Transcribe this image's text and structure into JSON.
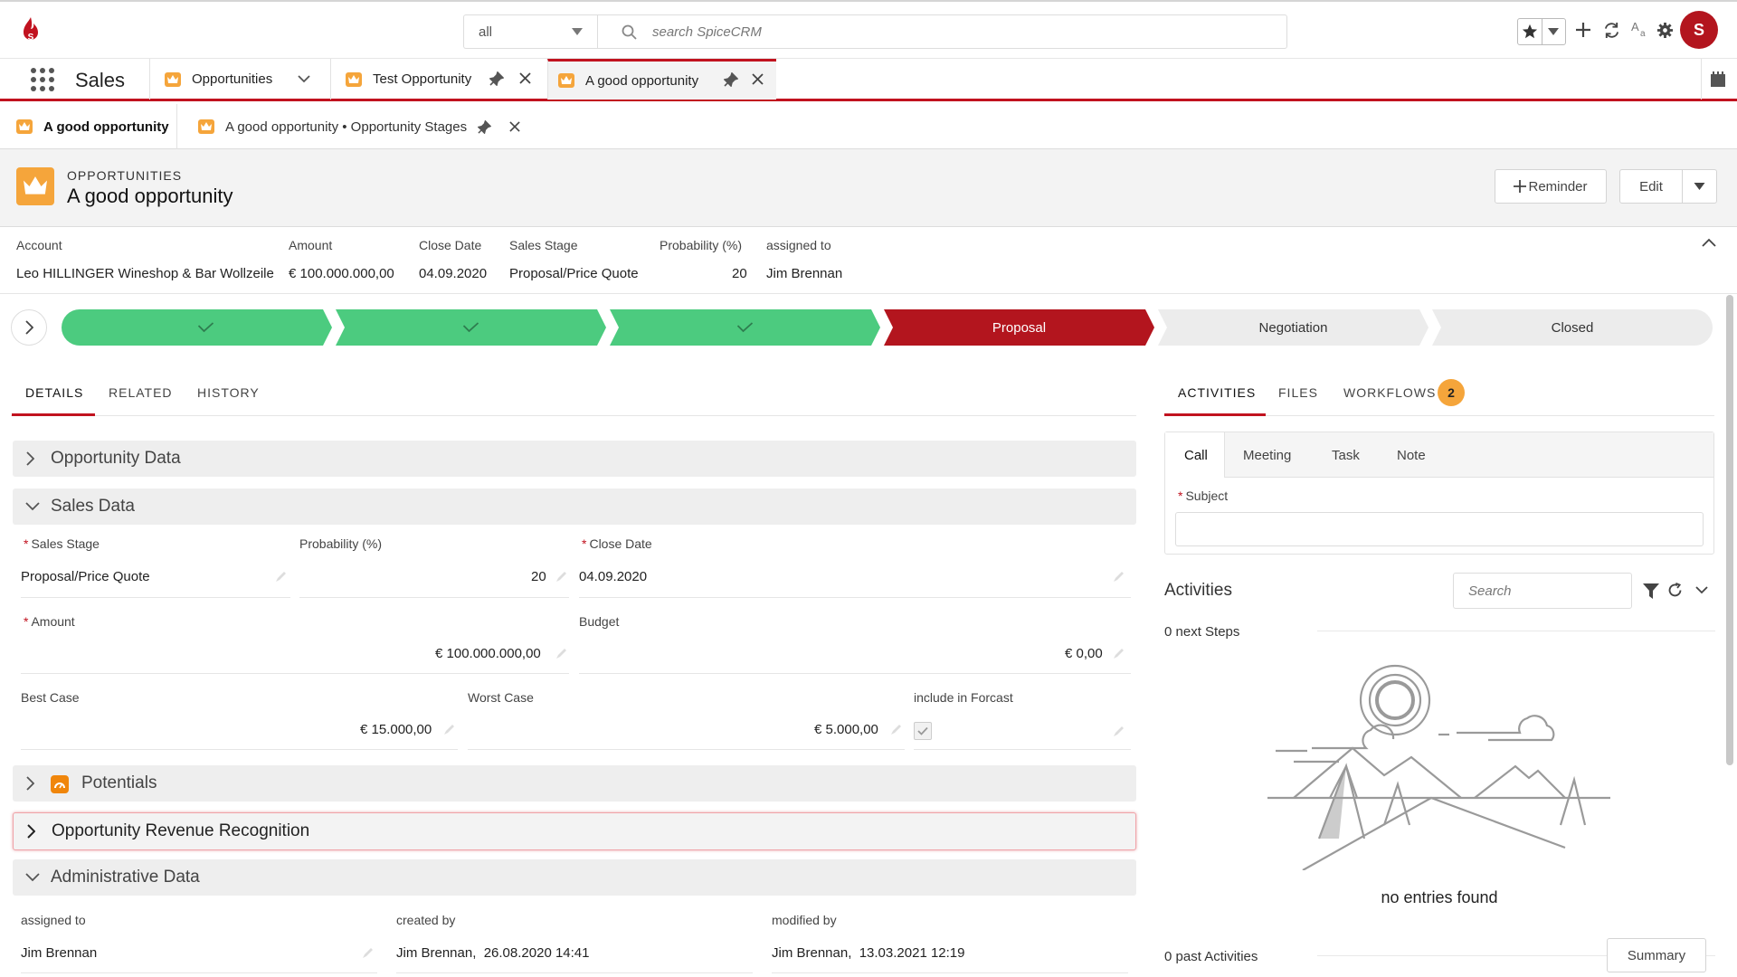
{
  "topbar": {
    "scope_value": "all",
    "search_placeholder": "search SpiceCRM",
    "avatar_initials": "S"
  },
  "module_bar": {
    "module_name": "Sales",
    "tabs": [
      {
        "label": "Opportunities"
      },
      {
        "label": "Test Opportunity"
      },
      {
        "label": "A good opportunity"
      }
    ]
  },
  "sub_tabs": [
    {
      "label": "A good opportunity"
    },
    {
      "label": "A good opportunity • Opportunity Stages"
    }
  ],
  "record": {
    "module_label": "OPPORTUNITIES",
    "title": "A good opportunity",
    "reminder_label": "Reminder",
    "edit_label": "Edit"
  },
  "summary": {
    "fields": [
      {
        "label": "Account",
        "value": "Leo HILLINGER Wineshop & Bar Wollzeile"
      },
      {
        "label": "Amount",
        "value": "€ 100.000.000,00"
      },
      {
        "label": "Close Date",
        "value": "04.09.2020"
      },
      {
        "label": "Sales Stage",
        "value": "Proposal/Price Quote"
      },
      {
        "label": "Probability (%)",
        "value": "20"
      },
      {
        "label": "assigned to",
        "value": "Jim Brennan"
      }
    ]
  },
  "stages": [
    {
      "label": "",
      "status": "done"
    },
    {
      "label": "",
      "status": "done"
    },
    {
      "label": "",
      "status": "done"
    },
    {
      "label": "Proposal",
      "status": "current"
    },
    {
      "label": "Negotiation",
      "status": "todo"
    },
    {
      "label": "Closed",
      "status": "todo"
    }
  ],
  "colors": {
    "done": "#4ccb7f",
    "current": "#b3151e",
    "todo": "#ececec",
    "accent": "#c1121f",
    "crown": "#f5a53b"
  },
  "left_tabs": [
    "DETAILS",
    "RELATED",
    "HISTORY"
  ],
  "sections": {
    "opportunity_data": "Opportunity Data",
    "sales_data": "Sales Data",
    "potentials": "Potentials",
    "revenue_recognition": "Opportunity Revenue Recognition",
    "administrative_data": "Administrative Data"
  },
  "sales_data": {
    "sales_stage_label": "Sales Stage",
    "sales_stage_value": "Proposal/Price Quote",
    "probability_label": "Probability (%)",
    "probability_value": "20",
    "close_date_label": "Close Date",
    "close_date_value": "04.09.2020",
    "amount_label": "Amount",
    "amount_value": "€ 100.000.000,00",
    "budget_label": "Budget",
    "budget_value": "€ 0,00",
    "best_case_label": "Best Case",
    "best_case_value": "€ 15.000,00",
    "worst_case_label": "Worst Case",
    "worst_case_value": "€ 5.000,00",
    "forecast_label": "include in Forcast",
    "forecast_checked": true
  },
  "admin_data": {
    "assigned_label": "assigned to",
    "assigned_value": "Jim Brennan",
    "created_label": "created by",
    "created_value": "Jim Brennan,  26.08.2020 14:41",
    "modified_label": "modified by",
    "modified_value": "Jim Brennan,  13.03.2021 12:19"
  },
  "right_tabs": [
    "ACTIVITIES",
    "FILES",
    "WORKFLOWS"
  ],
  "workflows_count": "2",
  "activity_types": [
    "Call",
    "Meeting",
    "Task",
    "Note"
  ],
  "quick_create": {
    "subject_label": "Subject",
    "subject_value": ""
  },
  "activities": {
    "title": "Activities",
    "search_placeholder": "Search",
    "next_steps": "0 next Steps",
    "empty_text": "no entries found",
    "past_activities": "0 past Activities",
    "summary_label": "Summary"
  }
}
